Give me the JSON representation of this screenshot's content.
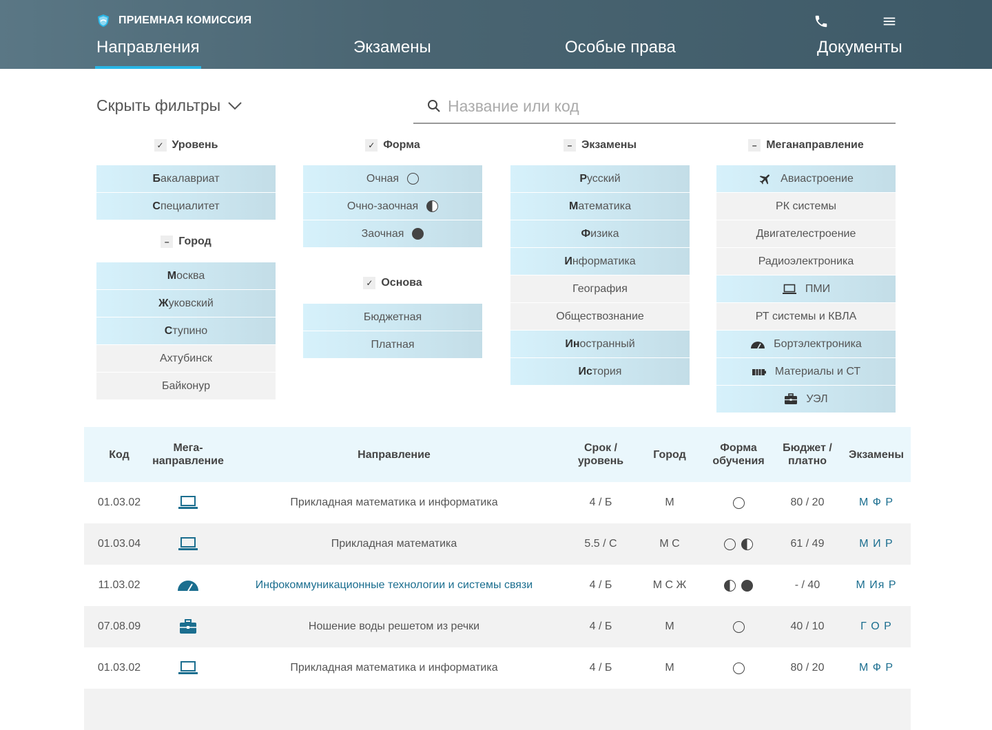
{
  "header": {
    "brand": "ПРИЕМНАЯ КОМИССИЯ",
    "icons": [
      "shield-logo-icon",
      "phone-icon",
      "menu-icon"
    ],
    "nav": [
      {
        "label": "Направления",
        "active": true
      },
      {
        "label": "Экзамены",
        "active": false
      },
      {
        "label": "Особые права",
        "active": false
      },
      {
        "label": "Документы",
        "active": false
      }
    ]
  },
  "filters": {
    "toggle_label": "Скрыть фильтры",
    "search_placeholder": "Название или код",
    "level": {
      "title": "Уровень",
      "mark": "✓",
      "items": [
        {
          "first": "Б",
          "rest": "акалавриат"
        },
        {
          "first": "С",
          "rest": "пециалитет"
        }
      ]
    },
    "city": {
      "title": "Город",
      "mark": "–",
      "items": [
        {
          "first": "М",
          "rest": "осква",
          "on": true
        },
        {
          "first": "Ж",
          "rest": "уковский",
          "on": true
        },
        {
          "first": "С",
          "rest": "тупино",
          "on": true
        },
        {
          "label": "Ахтубинск",
          "on": false
        },
        {
          "label": "Байконур",
          "on": false
        }
      ]
    },
    "form": {
      "title": "Форма",
      "mark": "✓",
      "items": [
        {
          "label": "Очная",
          "icon": "empty"
        },
        {
          "label": "Очно-заочная",
          "icon": "half"
        },
        {
          "label": "Заочная",
          "icon": "full"
        }
      ]
    },
    "basis": {
      "title": "Основа",
      "mark": "✓",
      "items": [
        {
          "label": "Бюджетная"
        },
        {
          "label": "Платная"
        }
      ]
    },
    "exams": {
      "title": "Экзамены",
      "mark": "–",
      "items": [
        {
          "first": "Р",
          "rest": "усский",
          "on": true
        },
        {
          "first": "М",
          "rest": "атематика",
          "on": true
        },
        {
          "first": "Ф",
          "rest": "изика",
          "on": true
        },
        {
          "first": "И",
          "rest": "нформатика",
          "on": true
        },
        {
          "label": "География",
          "on": false
        },
        {
          "label": "Обществознание",
          "on": false
        },
        {
          "first": "Ин",
          "rest": "остранный",
          "on": true
        },
        {
          "first": "Ис",
          "rest": "тория",
          "on": true
        }
      ]
    },
    "mega": {
      "title": "Меганаправление",
      "mark": "–",
      "items": [
        {
          "label": "Авиастроение",
          "icon": "airplane-icon",
          "on": true
        },
        {
          "label": "РК системы",
          "on": false
        },
        {
          "label": "Двигателестроение",
          "on": false
        },
        {
          "label": "Радиоэлектроника",
          "on": false
        },
        {
          "label": "ПМИ",
          "icon": "laptop-icon",
          "on": true
        },
        {
          "label": "РТ системы и КВЛА",
          "on": false
        },
        {
          "label": "Бортэлектроника",
          "icon": "gauge-icon",
          "on": true
        },
        {
          "label": "Материалы и СТ",
          "icon": "battery-icon",
          "on": true
        },
        {
          "label": "УЭЛ",
          "icon": "briefcase-icon",
          "on": true
        }
      ]
    }
  },
  "table": {
    "headers": {
      "code": "Код",
      "mega_1": "Мега-",
      "mega_2": "направление",
      "name": "Направление",
      "term_1": "Срок /",
      "term_2": "уровень",
      "city": "Город",
      "form_1": "Форма",
      "form_2": "обучения",
      "budget_1": "Бюджет /",
      "budget_2": "платно",
      "exams": "Экзамены"
    },
    "rows": [
      {
        "code": "01.03.02",
        "icon": "laptop-icon",
        "name": "Прикладная математика и информатика",
        "link": false,
        "term": "4 / Б",
        "city": "М",
        "forms": [
          "empty"
        ],
        "budget": "80 / 20",
        "exams": "М Ф Р"
      },
      {
        "code": "01.03.04",
        "icon": "laptop-icon",
        "name": "Прикладная математика",
        "link": false,
        "term": "5.5 / С",
        "city": "М С",
        "forms": [
          "empty",
          "half"
        ],
        "budget": "61 / 49",
        "exams": "М И Р"
      },
      {
        "code": "11.03.02",
        "icon": "gauge-icon",
        "name": "Инфокоммуникационные технологии и системы связи",
        "link": true,
        "term": "4 / Б",
        "city": "М С Ж",
        "forms": [
          "half",
          "full"
        ],
        "budget": "- / 40",
        "exams": "М Ия Р"
      },
      {
        "code": "07.08.09",
        "icon": "briefcase-icon",
        "name": "Ношение воды решетом из речки",
        "link": false,
        "term": "4 / Б",
        "city": "М",
        "forms": [
          "empty"
        ],
        "budget": "40 / 10",
        "exams": "Г О Р"
      },
      {
        "code": "01.03.02",
        "icon": "laptop-icon",
        "name": "Прикладная математика и информатика",
        "link": false,
        "term": "4 / Б",
        "city": "М",
        "forms": [
          "empty"
        ],
        "budget": "80 / 20",
        "exams": "М Ф Р"
      }
    ]
  },
  "colors": {
    "header": "#4a6572",
    "accent": "#29b6e6",
    "link": "#1b6e8f",
    "chip_on": "#d6f1fb",
    "chip_off": "#f2f2f2",
    "table_header": "#eaf7fc"
  }
}
